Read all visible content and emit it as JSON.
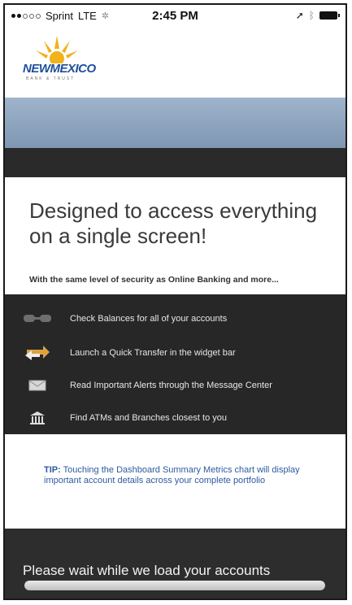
{
  "status_bar": {
    "carrier": "Sprint",
    "network": "LTE",
    "time": "2:45 PM"
  },
  "header": {
    "brand_name": "NEWMEXICO",
    "brand_sub": "BANK & TRUST",
    "brand_color": "#1f4e9c",
    "sun_color": "#f1b21b"
  },
  "hero": {
    "title": "Designed to access everything on a single screen!",
    "subtitle": "With the same level of security as Online Banking and more..."
  },
  "features": [
    {
      "icon": "glasses-icon",
      "text": "Check Balances for all of your accounts"
    },
    {
      "icon": "transfer-arrows-icon",
      "text": "Launch a Quick Transfer in the widget bar"
    },
    {
      "icon": "envelope-icon",
      "text": "Read Important Alerts through the Message Center"
    },
    {
      "icon": "bank-building-icon",
      "text": "Find ATMs and Branches closest to you"
    }
  ],
  "tip": {
    "label": "TIP:",
    "text": " Touching the Dashboard Summary Metrics chart will display important account details across your complete portfolio"
  },
  "loader": {
    "message": "Please wait while we load your accounts",
    "progress": 1.0
  }
}
